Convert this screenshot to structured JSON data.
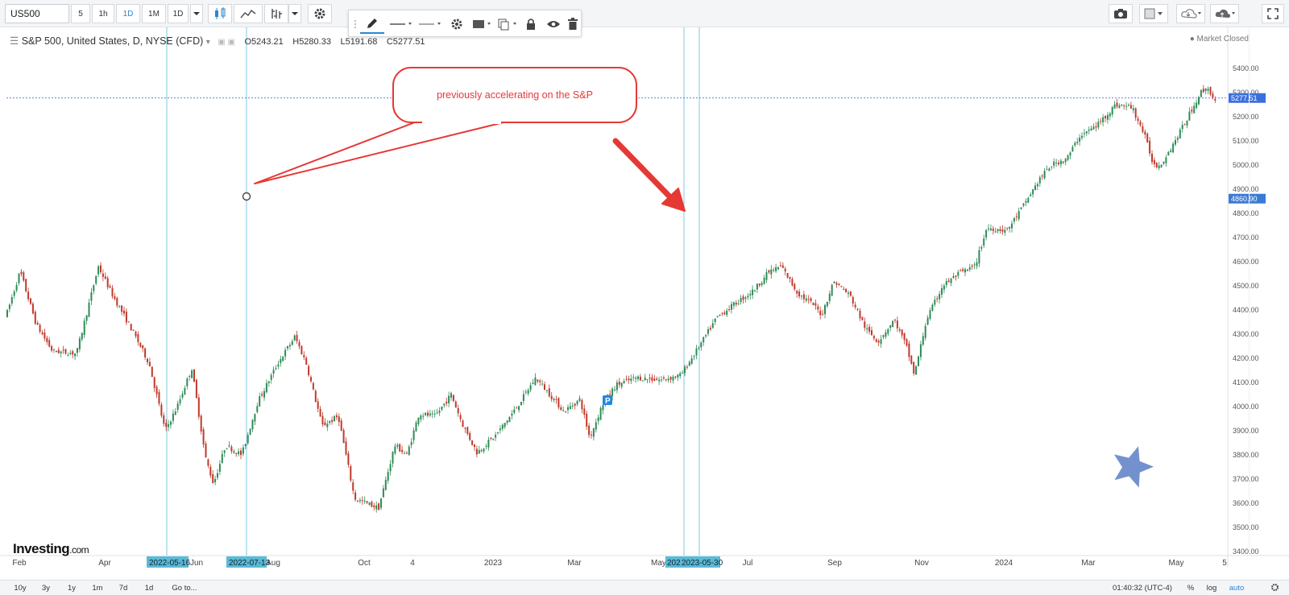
{
  "toolbar": {
    "symbol": "US500",
    "intervals": [
      "5",
      "1h",
      "1D",
      "1M",
      "1D"
    ],
    "active_interval_index": 2
  },
  "drawing_toolbar": {
    "items": [
      "pencil-icon",
      "line-style",
      "line-width",
      "gear-icon",
      "fill-icon",
      "clone-icon",
      "lock-icon",
      "eye-icon",
      "trash-icon"
    ]
  },
  "legend": {
    "title": "S&P 500, United States, D, NYSE (CFD)",
    "open": "O5243.21",
    "high": "H5280.33",
    "low": "L5191.68",
    "close": "C5277.51",
    "status": "● Market Closed"
  },
  "annotation": {
    "callout_text": "previously accelerating on the S&P"
  },
  "price_axis": {
    "labels": [
      "5500.00",
      "5400.00",
      "5300.00",
      "5200.00",
      "5100.00",
      "5000.00",
      "4900.00",
      "4800.00",
      "4700.00",
      "4600.00",
      "4500.00",
      "4400.00",
      "4300.00",
      "4200.00",
      "4100.00",
      "4000.00",
      "3900.00",
      "3800.00",
      "3700.00",
      "3600.00",
      "3500.00",
      "3400.00"
    ],
    "last_price": "5277.51",
    "cursor_price": "4860.90"
  },
  "time_axis": {
    "labels": [
      "Feb",
      "Apr",
      "Jun",
      "Aug",
      "Oct",
      "4",
      "2023",
      "Mar",
      "May",
      "Jul",
      "Sep",
      "Nov",
      "2024",
      "Mar",
      "May",
      "5"
    ],
    "highlight_1": "2022-05-16",
    "highlight_2": "2022-07-13",
    "highlight_3a": "202",
    "highlight_3b": "2023-05-30"
  },
  "bottom_bar": {
    "ranges": [
      "10y",
      "3y",
      "1y",
      "1m",
      "7d",
      "1d",
      "Go to..."
    ],
    "clock": "01:40:32 (UTC-4)",
    "percent": "%",
    "log": "log",
    "auto": "auto"
  },
  "brand": {
    "name": "Investing",
    "suffix": ".com"
  },
  "marker_label": "P",
  "colors": {
    "up": "#2e8b57",
    "down": "#c0392b",
    "accent": "#2a87d0",
    "annotation": "#e53935",
    "vline": "#7ec8e3",
    "price_line": "#2a5bd7"
  },
  "chart_data": {
    "type": "candlestick",
    "title": "S&P 500, United States, D, NYSE (CFD)",
    "ylim": [
      3400,
      5500
    ],
    "x": [
      "2022-01",
      "2022-02",
      "2022-03",
      "2022-04",
      "2022-05",
      "2022-06",
      "2022-07",
      "2022-08",
      "2022-09",
      "2022-10",
      "2022-11",
      "2022-12",
      "2023-01",
      "2023-02",
      "2023-03",
      "2023-04",
      "2023-05",
      "2023-06",
      "2023-07",
      "2023-08",
      "2023-09",
      "2023-10",
      "2023-11",
      "2023-12",
      "2024-01",
      "2024-02",
      "2024-03",
      "2024-04",
      "2024-05"
    ],
    "close": [
      4500,
      4380,
      4550,
      4130,
      4000,
      3800,
      4130,
      3950,
      3600,
      3870,
      4080,
      3840,
      4080,
      3970,
      4100,
      4170,
      4180,
      4450,
      4590,
      4510,
      4290,
      4190,
      4570,
      4770,
      4850,
      5100,
      5250,
      5030,
      5277.51
    ]
  }
}
